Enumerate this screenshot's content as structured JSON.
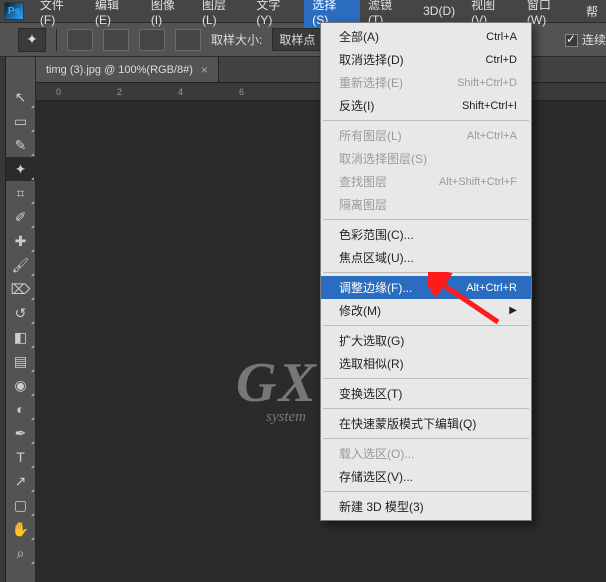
{
  "menubar": {
    "items": [
      {
        "label": "文件(F)"
      },
      {
        "label": "编辑(E)"
      },
      {
        "label": "图像(I)"
      },
      {
        "label": "图层(L)"
      },
      {
        "label": "文字(Y)"
      },
      {
        "label": "选择(S)"
      },
      {
        "label": "滤镜(T)"
      },
      {
        "label": "3D(D)"
      },
      {
        "label": "视图(V)"
      },
      {
        "label": "窗口(W)"
      },
      {
        "label": "帮"
      }
    ],
    "active_index": 5
  },
  "optionsbar": {
    "sample_label": "取样大小:",
    "sample_value": "取样点",
    "checkbox_label": "连续"
  },
  "document": {
    "tab_title": "timg (3).jpg @ 100%(RGB/8#)",
    "ruler_marks": [
      "0",
      "2",
      "4",
      "6"
    ]
  },
  "toolbar": {
    "tools": [
      {
        "name": "move-tool",
        "glyph": "↖"
      },
      {
        "name": "marquee-tool",
        "glyph": "▭"
      },
      {
        "name": "lasso-tool",
        "glyph": "✎"
      },
      {
        "name": "magic-wand-tool",
        "glyph": "✦",
        "active": true
      },
      {
        "name": "crop-tool",
        "glyph": "⌗"
      },
      {
        "name": "eyedropper-tool",
        "glyph": "✐"
      },
      {
        "name": "spot-heal-tool",
        "glyph": "✚"
      },
      {
        "name": "brush-tool",
        "glyph": "🖌"
      },
      {
        "name": "stamp-tool",
        "glyph": "⌦"
      },
      {
        "name": "history-brush-tool",
        "glyph": "↺"
      },
      {
        "name": "eraser-tool",
        "glyph": "◧"
      },
      {
        "name": "gradient-tool",
        "glyph": "▤"
      },
      {
        "name": "blur-tool",
        "glyph": "◉"
      },
      {
        "name": "dodge-tool",
        "glyph": "◐"
      },
      {
        "name": "pen-tool",
        "glyph": "✒"
      },
      {
        "name": "type-tool",
        "glyph": "T"
      },
      {
        "name": "path-select-tool",
        "glyph": "↗"
      },
      {
        "name": "shape-tool",
        "glyph": "▢"
      },
      {
        "name": "hand-tool",
        "glyph": "✋"
      },
      {
        "name": "zoom-tool",
        "glyph": "⌕"
      }
    ]
  },
  "menu": {
    "items": [
      {
        "label": "全部(A)",
        "shortcut": "Ctrl+A"
      },
      {
        "label": "取消选择(D)",
        "shortcut": "Ctrl+D"
      },
      {
        "label": "重新选择(E)",
        "shortcut": "Shift+Ctrl+D",
        "disabled": true
      },
      {
        "label": "反选(I)",
        "shortcut": "Shift+Ctrl+I"
      },
      {
        "sep": true
      },
      {
        "label": "所有图层(L)",
        "shortcut": "Alt+Ctrl+A",
        "disabled": true
      },
      {
        "label": "取消选择图层(S)",
        "disabled": true
      },
      {
        "label": "查找图层",
        "shortcut": "Alt+Shift+Ctrl+F",
        "disabled": true
      },
      {
        "label": "隔离图层",
        "disabled": true
      },
      {
        "sep": true
      },
      {
        "label": "色彩范围(C)..."
      },
      {
        "label": "焦点区域(U)..."
      },
      {
        "sep": true
      },
      {
        "label": "调整边缘(F)...",
        "shortcut": "Alt+Ctrl+R",
        "highlight": true
      },
      {
        "label": "修改(M)",
        "submenu": true
      },
      {
        "sep": true
      },
      {
        "label": "扩大选取(G)"
      },
      {
        "label": "选取相似(R)"
      },
      {
        "sep": true
      },
      {
        "label": "变换选区(T)"
      },
      {
        "sep": true
      },
      {
        "label": "在快速蒙版模式下编辑(Q)"
      },
      {
        "sep": true
      },
      {
        "label": "载入选区(O)...",
        "disabled": true
      },
      {
        "label": "存储选区(V)..."
      },
      {
        "sep": true
      },
      {
        "label": "新建 3D 模型(3)"
      }
    ]
  },
  "watermark": {
    "big": "GX",
    "sub": "system"
  }
}
